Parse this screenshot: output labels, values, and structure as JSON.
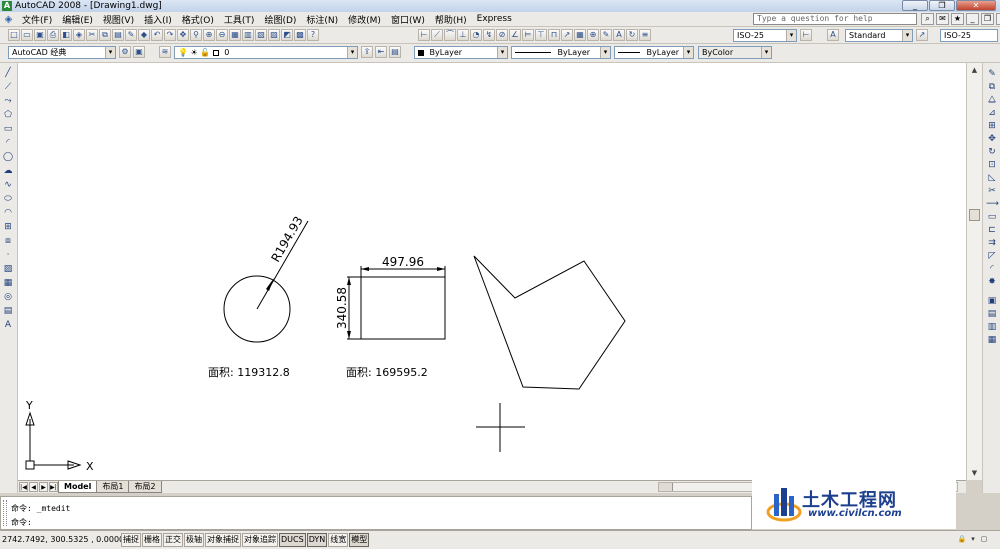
{
  "window": {
    "title": "AutoCAD 2008 - [Drawing1.dwg]",
    "app_icon": "autocad-icon",
    "controls": {
      "minimize": "_",
      "restore": "❐",
      "close": "✕"
    }
  },
  "menu": {
    "items": [
      "文件(F)",
      "编辑(E)",
      "视图(V)",
      "插入(I)",
      "格式(O)",
      "工具(T)",
      "绘图(D)",
      "标注(N)",
      "修改(M)",
      "窗口(W)",
      "帮助(H)",
      "Express"
    ],
    "help_placeholder": "Type a question for help"
  },
  "toolbars": {
    "dim_style": "ISO-25",
    "text_style": "Standard",
    "dim_style_2": "ISO-25",
    "workspace": "AutoCAD 经典",
    "layer": "0",
    "color": "ByLayer",
    "linetype": "ByLayer",
    "lineweight": "ByLayer",
    "plot_style": "ByColor"
  },
  "drawing": {
    "circle_dimension": "R194.93",
    "rect_width_dimension": "497.96",
    "rect_height_dimension": "340.58",
    "circle_area": "面积: 119312.8",
    "rect_area": "面积: 169595.2",
    "ucs_x": "X",
    "ucs_y": "Y"
  },
  "tabs": [
    "Model",
    "布局1",
    "布局2"
  ],
  "command": {
    "line1": "命令: _mtedit",
    "line2": "命令:"
  },
  "status": {
    "coordinates": "2742.7492, 300.5325 , 0.0000",
    "buttons": [
      "捕捉",
      "栅格",
      "正交",
      "极轴",
      "对象捕捉",
      "对象追踪",
      "DUCS",
      "DYN",
      "线宽",
      "模型"
    ],
    "active": [
      "DUCS",
      "DYN",
      "模型"
    ]
  },
  "watermark": {
    "title": "土木工程网",
    "url": "www.civilcn.com"
  }
}
